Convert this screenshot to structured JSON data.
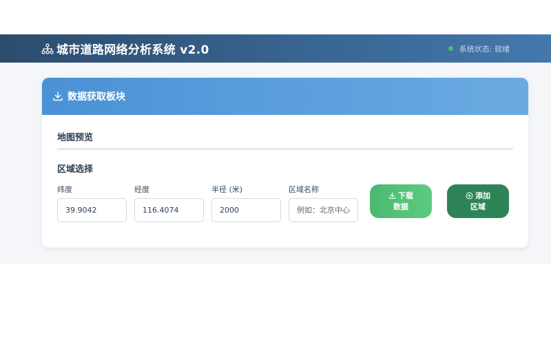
{
  "header": {
    "title": "城市道路网络分析系统 v2.0",
    "status": "系统状态: 就绪",
    "status_color": "#4cbb6a"
  },
  "data_panel": {
    "title": "数据获取板块",
    "map_preview_title": "地图预览",
    "region_select_title": "区域选择",
    "fields": {
      "latitude": {
        "label": "纬度",
        "value": "39.9042"
      },
      "longitude": {
        "label": "经度",
        "value": "116.4074"
      },
      "radius": {
        "label": "半径 (米)",
        "value": "2000"
      },
      "region_name": {
        "label": "区域名称",
        "value": "",
        "placeholder": "例如：北京中心"
      }
    },
    "buttons": {
      "download": {
        "line1": "下载",
        "line2": "数据",
        "icon": "download-icon"
      },
      "add_region": {
        "line1": "添加",
        "line2": "区域",
        "icon": "plus-circle-icon"
      }
    }
  }
}
